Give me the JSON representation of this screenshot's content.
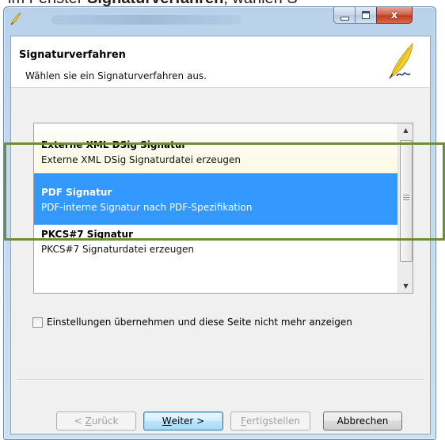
{
  "doc_caption": {
    "prefix": "im Fenster ",
    "bold": "Signaturverfahren",
    "suffix": ", wählen S"
  },
  "window": {
    "close_glyph": "x"
  },
  "header": {
    "title": "Signaturverfahren",
    "subtitle": "Wählen sie ein Signaturverfahren aus."
  },
  "list": {
    "items": [
      {
        "title": "Externe XML DSig Signatur",
        "description": "Externe XML DSig Signaturdatei erzeugen",
        "state": "hover"
      },
      {
        "title": "PDF Signatur",
        "description": "PDF-interne Signatur nach PDF-Spezifikation",
        "state": "selected"
      },
      {
        "title": "PKCS#7 Signatur",
        "description": "PKCS#7 Signaturdatei erzeugen",
        "state": "normal"
      }
    ]
  },
  "checkbox": {
    "label": "Einstellungen übernehmen und diese Seite nicht mehr anzeigen",
    "checked": false
  },
  "buttons": {
    "back": {
      "prefix": "< ",
      "mnemonic": "Z",
      "rest": "urück",
      "enabled": false
    },
    "next": {
      "mnemonic": "W",
      "rest": "eiter >",
      "enabled": true
    },
    "finish": {
      "mnemonic": "F",
      "rest": "ertigstellen",
      "enabled": false
    },
    "cancel": {
      "label": "Abbrechen",
      "enabled": true
    }
  },
  "colors": {
    "selection": "#3399ff",
    "hover": "#fdfbe5",
    "highlight_box": "#6e8d3a",
    "title_bar": "#b9d1ea"
  },
  "icons": {
    "app": "quill-icon",
    "logo": "quill-logo"
  }
}
